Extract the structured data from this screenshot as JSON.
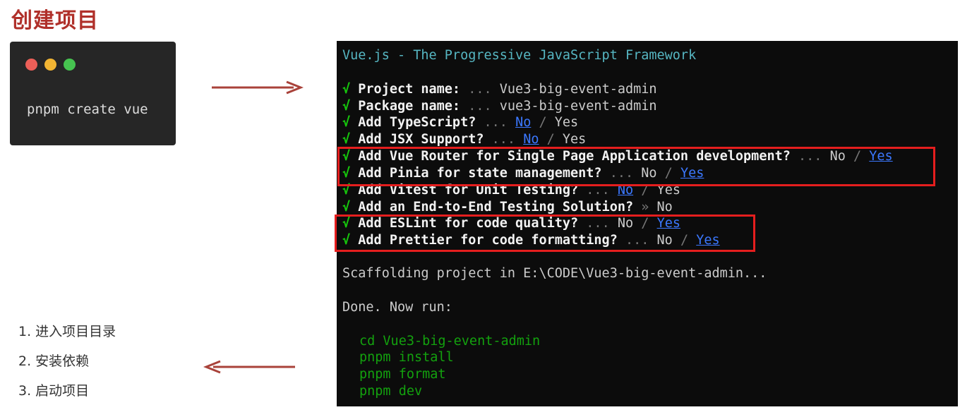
{
  "page_title": "创建项目",
  "command_window": {
    "dots": [
      "red",
      "yellow",
      "green"
    ],
    "command": "pnpm create vue"
  },
  "terminal": {
    "header": "Vue.js - The Progressive JavaScript Framework",
    "prompts": [
      {
        "check": "√",
        "question": "Project name:",
        "dots": " ... ",
        "answer": "Vue3-big-event-admin"
      },
      {
        "check": "√",
        "question": "Package name:",
        "dots": " ... ",
        "answer": "vue3-big-event-admin"
      },
      {
        "check": "√",
        "question": "Add TypeScript?",
        "dots": " ... ",
        "no": "No",
        "sep": " / ",
        "yes": "Yes",
        "selected": "No"
      },
      {
        "check": "√",
        "question": "Add JSX Support?",
        "dots": " ... ",
        "no": "No",
        "sep": " / ",
        "yes": "Yes",
        "selected": "No"
      },
      {
        "check": "√",
        "question": "Add Vue Router for Single Page Application development?",
        "dots": " ... ",
        "no": "No",
        "sep": " / ",
        "yes": "Yes",
        "selected": "Yes"
      },
      {
        "check": "√",
        "question": "Add Pinia for state management?",
        "dots": " ... ",
        "no": "No",
        "sep": " / ",
        "yes": "Yes",
        "selected": "Yes"
      },
      {
        "check": "√",
        "question": "Add Vitest for Unit Testing?",
        "dots": " ... ",
        "no": "No",
        "sep": " / ",
        "yes": "Yes",
        "selected": "No"
      },
      {
        "check": "√",
        "question": "Add an End-to-End Testing Solution?",
        "dots": " » ",
        "answer": "No"
      },
      {
        "check": "√",
        "question": "Add ESLint for code quality?",
        "dots": " ... ",
        "no": "No",
        "sep": " / ",
        "yes": "Yes",
        "selected": "Yes"
      },
      {
        "check": "√",
        "question": "Add Prettier for code formatting?",
        "dots": " ... ",
        "no": "No",
        "sep": " / ",
        "yes": "Yes",
        "selected": "Yes"
      }
    ],
    "scaffolding": "Scaffolding project in E:\\CODE\\Vue3-big-event-admin...",
    "done": "Done. Now run:",
    "commands": [
      "cd Vue3-big-event-admin",
      "pnpm install",
      "pnpm format",
      "pnpm dev"
    ]
  },
  "steps": [
    "1. 进入项目目录",
    "2. 安装依赖",
    "3. 启动项目"
  ],
  "colors": {
    "title": "#b0302a",
    "arrow": "#a9423a",
    "highlight_box": "#e51e1e",
    "terminal_bg": "#0c0c0c",
    "check": "#16c60c",
    "selected": "#3b78ff",
    "command": "#13a10e"
  }
}
